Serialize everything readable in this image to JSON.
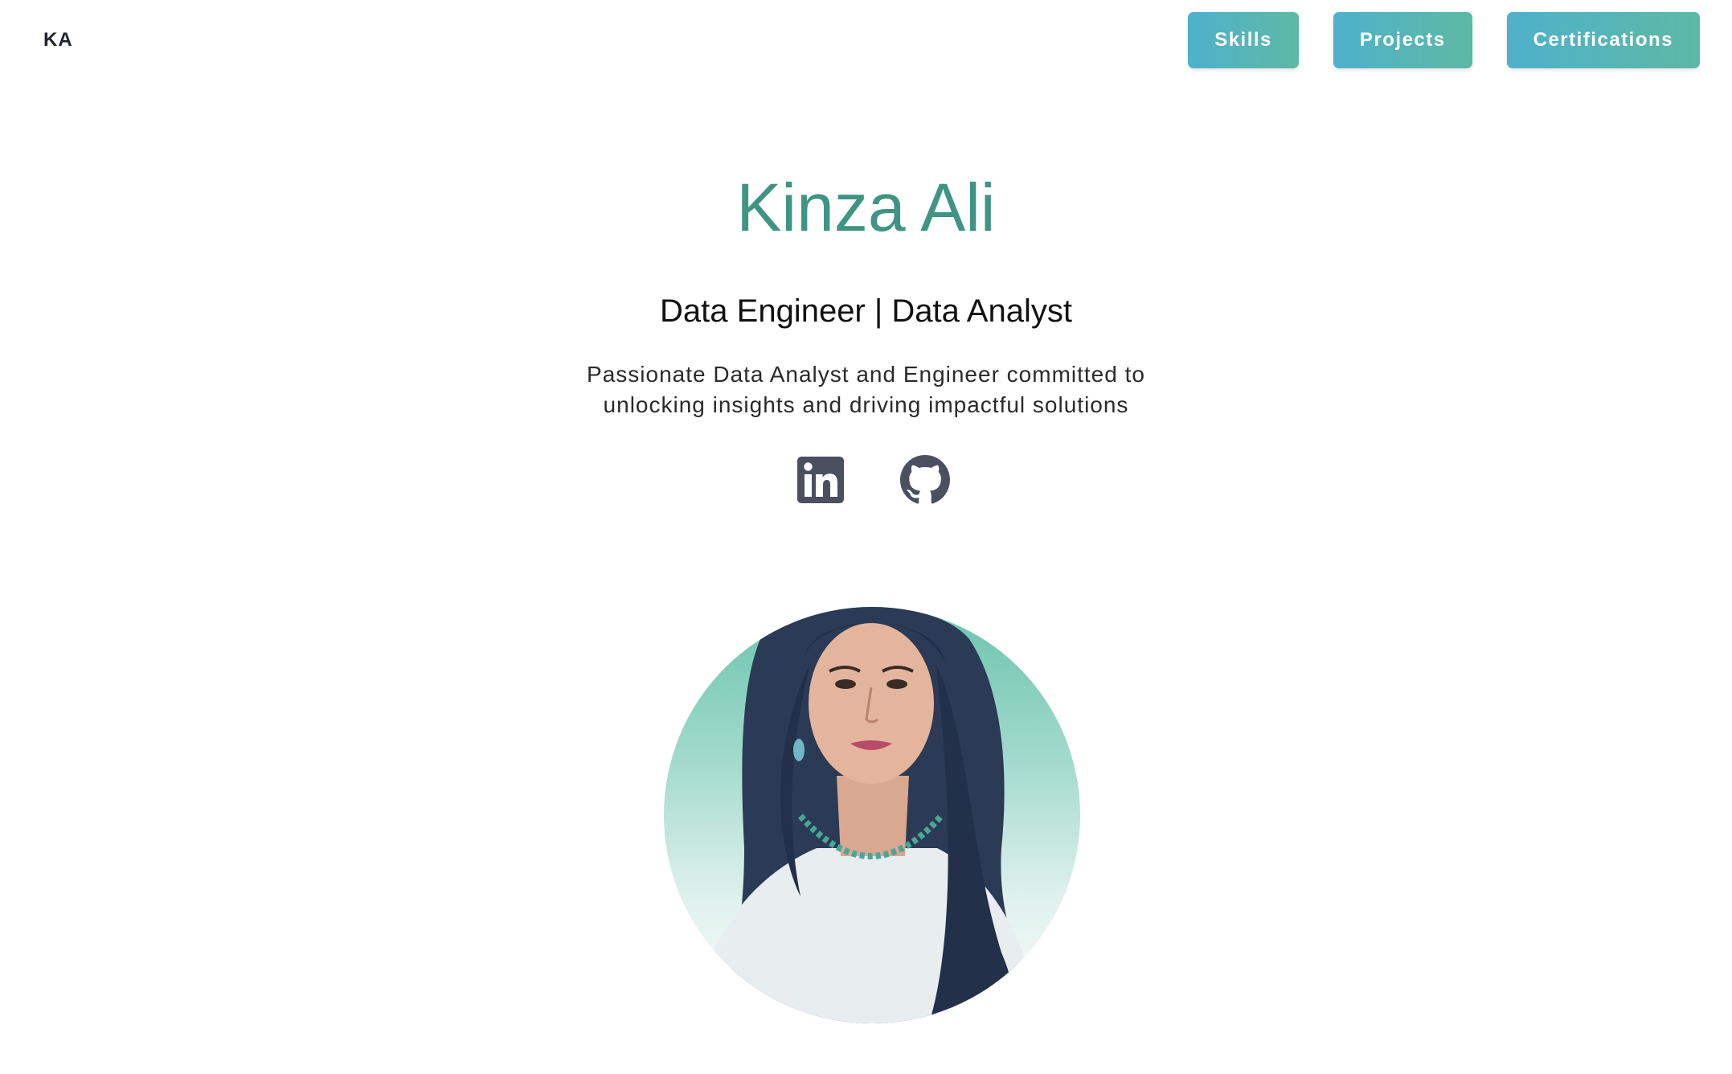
{
  "header": {
    "logo": "KA",
    "nav": [
      {
        "label": "Skills"
      },
      {
        "label": "Projects"
      },
      {
        "label": "Certifications"
      }
    ]
  },
  "hero": {
    "name": "Kinza Ali",
    "role": "Data Engineer | Data Analyst",
    "tagline": "Passionate Data Analyst and Engineer committed to unlocking insights and driving impactful solutions"
  },
  "socials": [
    {
      "icon": "linkedin-icon"
    },
    {
      "icon": "github-icon"
    }
  ],
  "colors": {
    "accent": "#3f9484",
    "button_gradient_start": "#4fb1cc",
    "button_gradient_end": "#5db9a4",
    "icon": "#4a5060"
  }
}
